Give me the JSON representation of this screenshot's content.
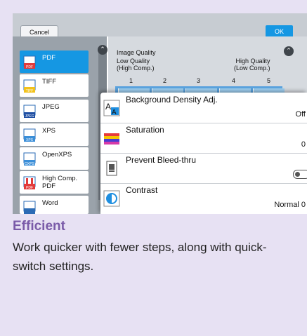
{
  "panel": {
    "cancel_label": "Cancel",
    "ok_label": "OK",
    "formats": [
      {
        "label": "PDF",
        "badge": "PDF",
        "selected": true
      },
      {
        "label": "TIFF",
        "badge": "TIFF",
        "selected": false
      },
      {
        "label": "JPEG",
        "badge": "JPEG",
        "selected": false
      },
      {
        "label": "XPS",
        "badge": "XPS",
        "selected": false
      },
      {
        "label": "OpenXPS",
        "badge": "OXPS",
        "selected": false
      },
      {
        "label": "High Comp. PDF",
        "badge": "PDF",
        "selected": false
      },
      {
        "label": "Word",
        "badge": "",
        "selected": false
      }
    ],
    "image_quality": {
      "title": "Image Quality",
      "low_label": "Low Quality\n(High Comp.)",
      "high_label": "High Quality\n(Low Comp.)",
      "levels": [
        "1",
        "2",
        "3",
        "4",
        "5"
      ]
    },
    "popup": [
      {
        "title": "Background Density Adj.",
        "value": "Off",
        "icon": "density-icon"
      },
      {
        "title": "Saturation",
        "value": "0",
        "icon": "saturation-icon"
      },
      {
        "title": "Prevent Bleed-thru",
        "value": "",
        "icon": "bleed-thru-icon",
        "toggle": "off"
      },
      {
        "title": "Contrast",
        "value": "Normal 0",
        "icon": "contrast-icon"
      }
    ],
    "colors": {
      "accent": "#1597e3",
      "heading": "#7a5ba8",
      "card_bg": "#e7e1f3"
    }
  },
  "feature": {
    "heading": "Efficient",
    "description": "Work quicker with fewer steps, along with quick-switch settings."
  }
}
